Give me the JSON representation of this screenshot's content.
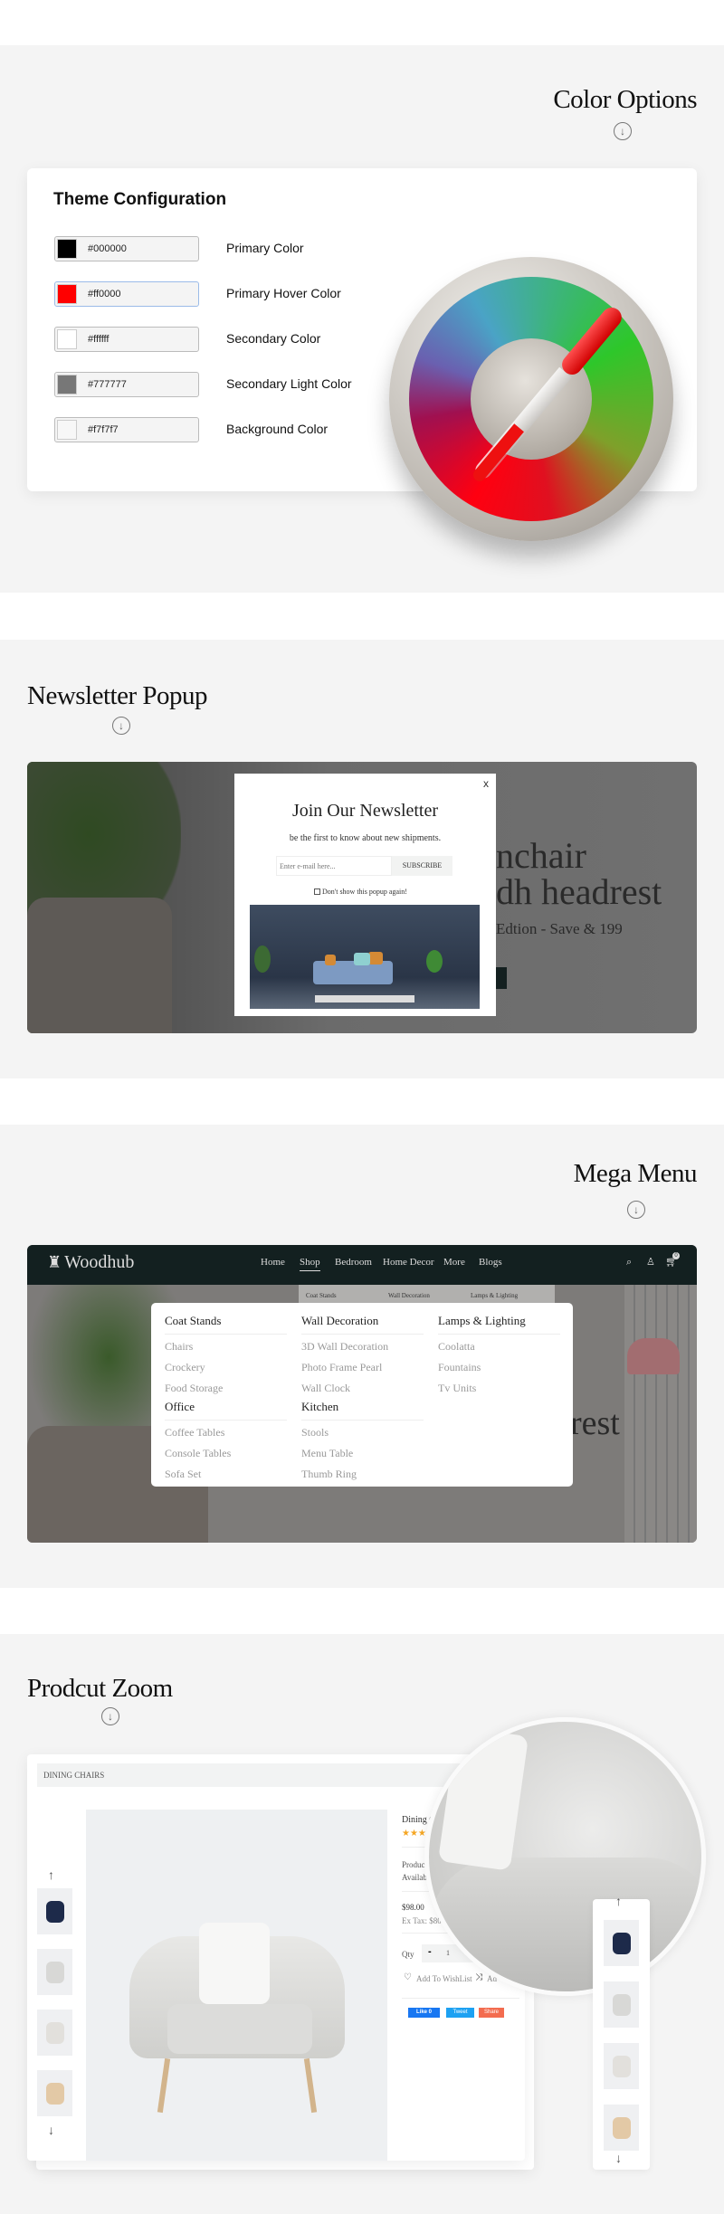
{
  "color_options": {
    "title": "Color Options",
    "arrow_icon": "arrow-down-circle-icon",
    "card_title": "Theme Configuration",
    "rows": [
      {
        "hex": "#000000",
        "label": "Primary Color",
        "swatch": "#000000"
      },
      {
        "hex": "#ff0000",
        "label": "Primary Hover Color",
        "swatch": "#ff0000"
      },
      {
        "hex": "#ffffff",
        "label": "Secondary Color",
        "swatch": "#ffffff"
      },
      {
        "hex": "#777777",
        "label": "Secondary Light Color",
        "swatch": "#777777"
      },
      {
        "hex": "#f7f7f7",
        "label": "Background Color",
        "swatch": "#f7f7f7"
      }
    ]
  },
  "newsletter": {
    "title": "Newsletter Popup",
    "popup_title": "Join Our Newsletter",
    "subtitle": "be the first to know about new shipments.",
    "email_placeholder": "Enter e-mail here...",
    "subscribe_label": "SUBSCRIBE",
    "dont_show_label": "Don't show this popup again!",
    "close_label": "x",
    "banner_line1": "nchair",
    "banner_line2": "dh headrest",
    "banner_line3": "Edtion - Save & 199"
  },
  "mega_menu": {
    "title": "Mega Menu",
    "logo": "Woodhub",
    "nav": [
      "Home",
      "Shop",
      "Bedroom",
      "Home Decor",
      "More",
      "Blogs"
    ],
    "active_nav": "Shop",
    "cart_count": "0",
    "sub_bar": [
      "Coat Stands",
      "Wall Decoration",
      "Lamps & Lighting"
    ],
    "banner_text": "rest",
    "columns": [
      {
        "groups": [
          {
            "heading": "Coat Stands",
            "items": [
              "Chairs",
              "Crockery",
              "Food Storage"
            ]
          },
          {
            "heading": "Office",
            "items": [
              "Coffee Tables",
              "Console Tables",
              "Sofa Set"
            ]
          }
        ]
      },
      {
        "groups": [
          {
            "heading": "Wall Decoration",
            "items": [
              "3D Wall Decoration",
              "Photo Frame Pearl",
              "Wall Clock"
            ]
          },
          {
            "heading": "Kitchen",
            "items": [
              "Stools",
              "Menu Table",
              "Thumb Ring"
            ]
          }
        ]
      },
      {
        "groups": [
          {
            "heading": "Lamps & Lighting",
            "items": [
              "Coolatta",
              "Fountains",
              "Tv Units"
            ]
          }
        ]
      }
    ]
  },
  "product_zoom": {
    "title": "Prodcut Zoom",
    "breadcrumb": "DINING CHAIRS",
    "product_name": "Dining C",
    "rating_stars": 3,
    "product_code_label": "Product",
    "availability_label": "Availabil",
    "price": "$98.00",
    "ex_tax": "Ex Tax: $80.0",
    "qty_label": "Qty",
    "qty_minus": "-",
    "qty_value": "1",
    "wishlist_label": "Add To WishList",
    "compare_label": "Ad",
    "social": {
      "like": "Like 0",
      "tweet": "Tweet",
      "share": "Share"
    },
    "colors": {
      "like": "#1877f2",
      "tweet": "#1da1f2",
      "share": "#f36c4f",
      "star": "#f5a623"
    }
  }
}
